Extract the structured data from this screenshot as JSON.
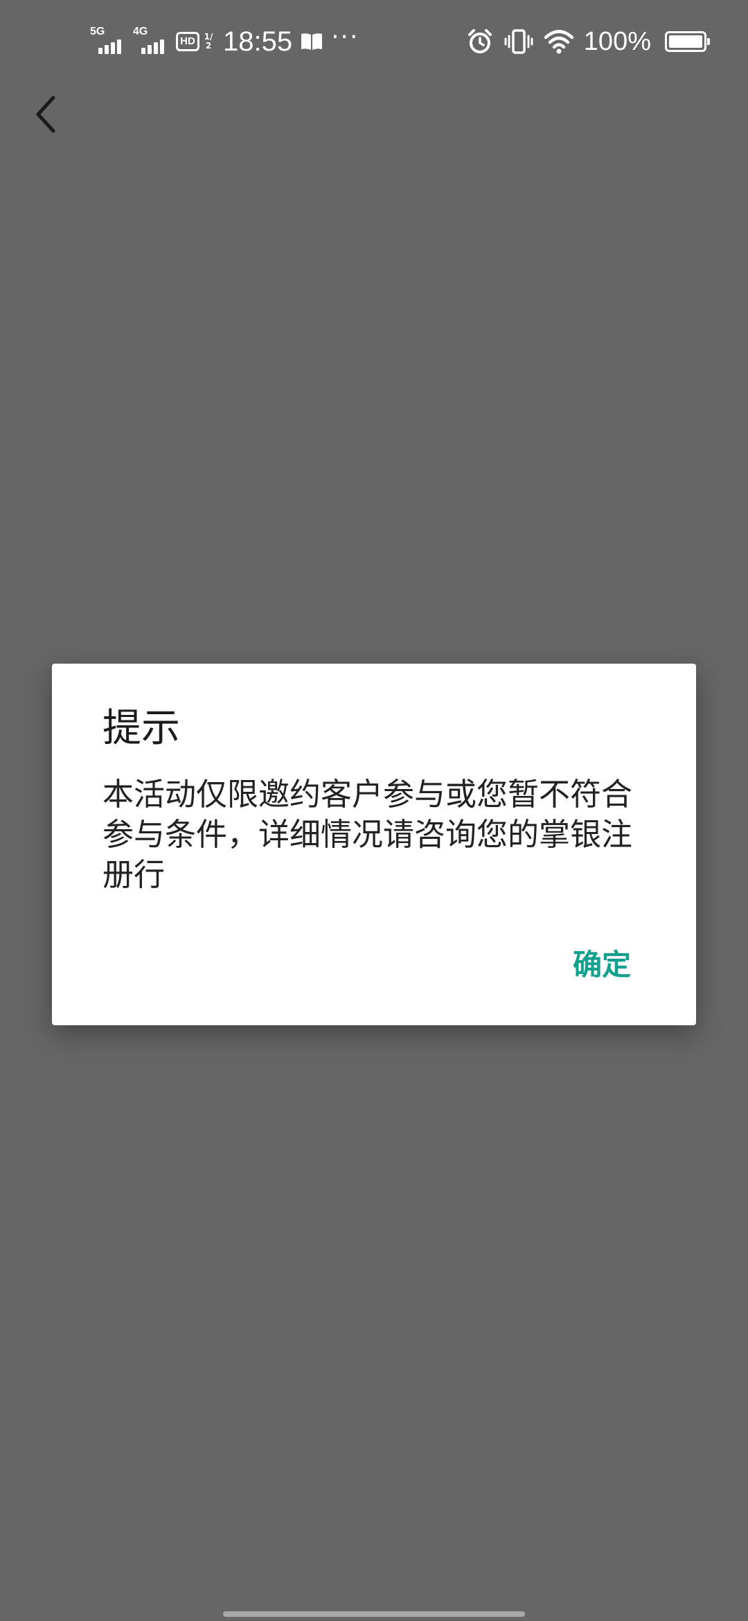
{
  "status_bar": {
    "signal_1_tag": "5G",
    "signal_2_tag": "4G",
    "hd_label": "HD",
    "hd_fraction": "1/2",
    "time": "18:55",
    "more_indicator": "···",
    "battery_percent": "100%",
    "battery_level": 1.0,
    "icons": [
      "signal-5g-icon",
      "signal-4g-icon",
      "hd-voice-icon",
      "book-icon",
      "alarm-icon",
      "vibrate-icon",
      "wifi-icon",
      "battery-icon"
    ]
  },
  "nav": {
    "back_icon": "chevron-left-icon"
  },
  "dialog": {
    "title": "提示",
    "message": "本活动仅限邀约客户参与或您暂不符合参与条件，详细情况请咨询您的掌银注册行",
    "confirm_label": "确定"
  },
  "colors": {
    "backdrop": "#666666",
    "dialog_background": "#ffffff",
    "accent": "#14a08c",
    "text": "#222222"
  }
}
